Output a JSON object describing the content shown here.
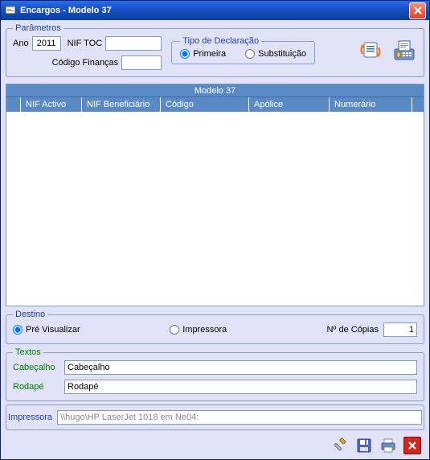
{
  "window": {
    "title": "Encargos - Modelo 37"
  },
  "params": {
    "legend": "Parâmetros",
    "ano_label": "Ano",
    "ano_value": "2011",
    "nif_toc_label": "NIF TOC",
    "nif_toc_value": "",
    "codigo_financas_label": "Código Finanças",
    "codigo_financas_value": "",
    "tipo": {
      "legend": "Tipo de Declaração",
      "primeira": "Primeira",
      "substituicao": "Substituição"
    }
  },
  "grid": {
    "title": "Modelo 37",
    "columns": [
      "NIF Activo",
      "NIF Beneficiário",
      "Código",
      "Apólice",
      "Numerário"
    ]
  },
  "destino": {
    "legend": "Destino",
    "pre_visualizar": "Pré Visualizar",
    "impressora": "Impressora",
    "num_copias_label": "Nº de Cópias",
    "num_copias_value": "1"
  },
  "textos": {
    "legend": "Textos",
    "cabecalho_label": "Cabeçalho",
    "cabecalho_value": "Cabeçalho",
    "rodape_label": "Rodapé",
    "rodape_value": "Rodapé"
  },
  "impressora": {
    "label": "Impressora",
    "value": "\\\\hugo\\HP LaserJet 1018 em Ne04:"
  }
}
